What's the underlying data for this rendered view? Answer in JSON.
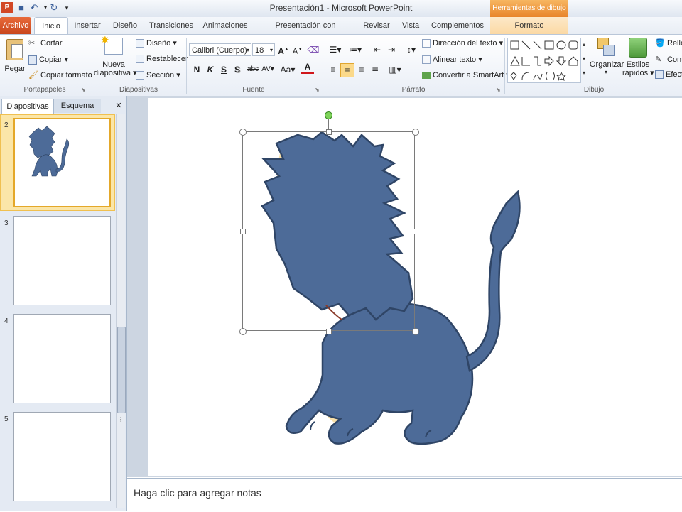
{
  "window": {
    "title": "Presentación1 - Microsoft PowerPoint"
  },
  "context_tab": {
    "label": "Herramientas de dibujo"
  },
  "tabs": {
    "file": "Archivo",
    "home": "Inicio",
    "insert": "Insertar",
    "design": "Diseño",
    "transitions": "Transiciones",
    "animations": "Animaciones",
    "slideshow": "Presentación con diapositivas",
    "review": "Revisar",
    "view": "Vista",
    "addins": "Complementos",
    "format": "Formato"
  },
  "clipboard": {
    "paste": "Pegar",
    "cut": "Cortar",
    "copy": "Copiar",
    "format_painter": "Copiar formato",
    "label": "Portapapeles"
  },
  "slides_group": {
    "new_slide_1": "Nueva",
    "new_slide_2": "diapositiva",
    "layout": "Diseño",
    "reset": "Restablecer",
    "section": "Sección",
    "label": "Diapositivas"
  },
  "font": {
    "name": "Calibri (Cuerpo)",
    "size": "18",
    "bold": "N",
    "italic": "K",
    "underline": "S",
    "shadow": "S",
    "strike": "abc",
    "label": "Fuente"
  },
  "paragraph": {
    "text_direction": "Dirección del texto",
    "align_text": "Alinear texto",
    "smartart": "Convertir a SmartArt",
    "label": "Párrafo"
  },
  "drawing": {
    "arrange": "Organizar",
    "quick_styles_1": "Estilos",
    "quick_styles_2": "rápidos",
    "fill": "Relleno",
    "outline": "Contorno",
    "effects": "Efectos",
    "label": "Dibujo"
  },
  "panel": {
    "tab_slides": "Diapositivas",
    "tab_outline": "Esquema",
    "close": "✕",
    "slide_numbers": [
      "2",
      "3",
      "4",
      "5"
    ]
  },
  "notes": {
    "placeholder": "Haga clic para agregar notas"
  },
  "colors": {
    "accent_file": "#d04f22",
    "lion_blue": "#4d6b98",
    "lion_outline": "#2f4566",
    "ghost_yellow": "#f6d58c"
  }
}
